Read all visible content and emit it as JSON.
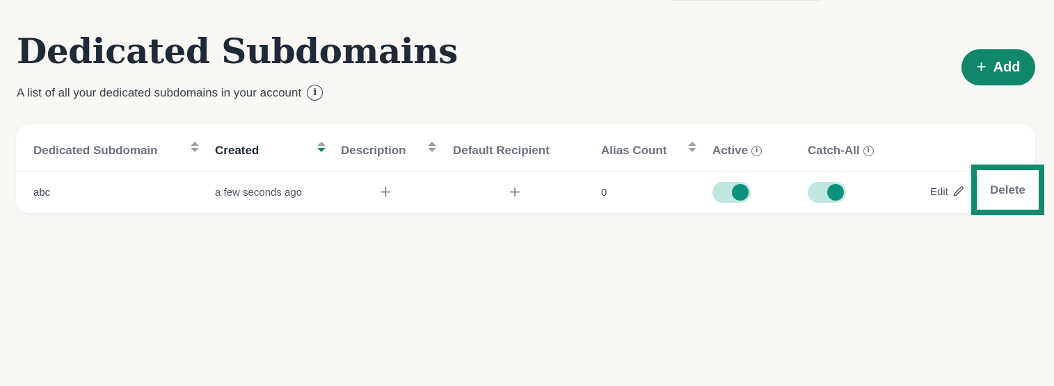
{
  "page": {
    "title": "Dedicated Subdomains",
    "subtitle": "A list of all your dedicated subdomains in your account"
  },
  "toolbar": {
    "add_label": "Add"
  },
  "table": {
    "columns": [
      {
        "label": "Dedicated Subdomain",
        "sortable": true,
        "sorted": false
      },
      {
        "label": "Created",
        "sortable": true,
        "sorted": true,
        "direction": "desc"
      },
      {
        "label": "Description",
        "sortable": true,
        "sorted": false
      },
      {
        "label": "Default Recipient",
        "sortable": false
      },
      {
        "label": "Alias Count",
        "sortable": true,
        "sorted": false
      },
      {
        "label": "Active",
        "info": true
      },
      {
        "label": "Catch-All",
        "info": true
      }
    ],
    "rows": [
      {
        "subdomain": "abc",
        "created": "a few seconds ago",
        "description": "+",
        "default_recipient": "+",
        "alias_count": "0",
        "active": true,
        "catch_all": true,
        "edit_label": "Edit",
        "delete_label": "Delete"
      }
    ]
  },
  "colors": {
    "accent": "#10866a",
    "toggle_track": "#bfe7e1",
    "toggle_knob": "#0f917d",
    "background": "#f8f7f3"
  },
  "icons": {
    "add": "plus-icon",
    "info": "info-icon",
    "sort": "sort-icon",
    "edit": "pencil-icon",
    "add_cell": "plus-icon"
  }
}
